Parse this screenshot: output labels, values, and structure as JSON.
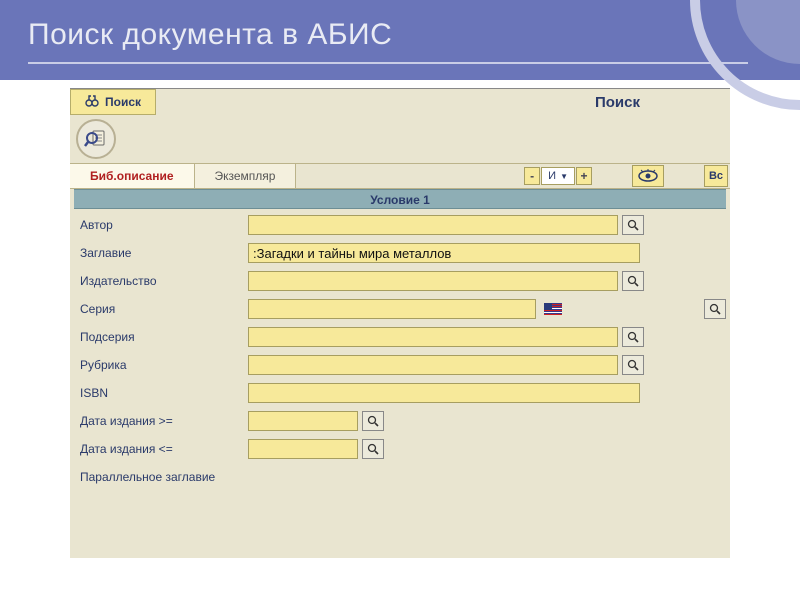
{
  "slide": {
    "title": "Поиск документа в АБИС"
  },
  "tabs": {
    "search_label": "Поиск",
    "right_title": "Поиск"
  },
  "mode": {
    "bib_desc": "Биб.описание",
    "exemplar": "Экземпляр",
    "logic_and": "И",
    "right_edge": "Вс"
  },
  "condition": {
    "header": "Условие 1"
  },
  "fields": {
    "author": {
      "label": "Автор",
      "value": ""
    },
    "title": {
      "label": "Заглавие",
      "value": ":Загадки и тайны мира металлов"
    },
    "publisher": {
      "label": "Издательство",
      "value": ""
    },
    "series": {
      "label": "Серия",
      "value": ""
    },
    "subseries": {
      "label": "Подсерия",
      "value": ""
    },
    "rubric": {
      "label": "Рубрика",
      "value": ""
    },
    "isbn": {
      "label": "ISBN",
      "value": ""
    },
    "date_gte": {
      "label": "Дата издания >=",
      "value": ""
    },
    "date_lte": {
      "label": "Дата издания <=",
      "value": ""
    },
    "parallel": {
      "label": "Параллельное заглавие",
      "value": ""
    }
  }
}
